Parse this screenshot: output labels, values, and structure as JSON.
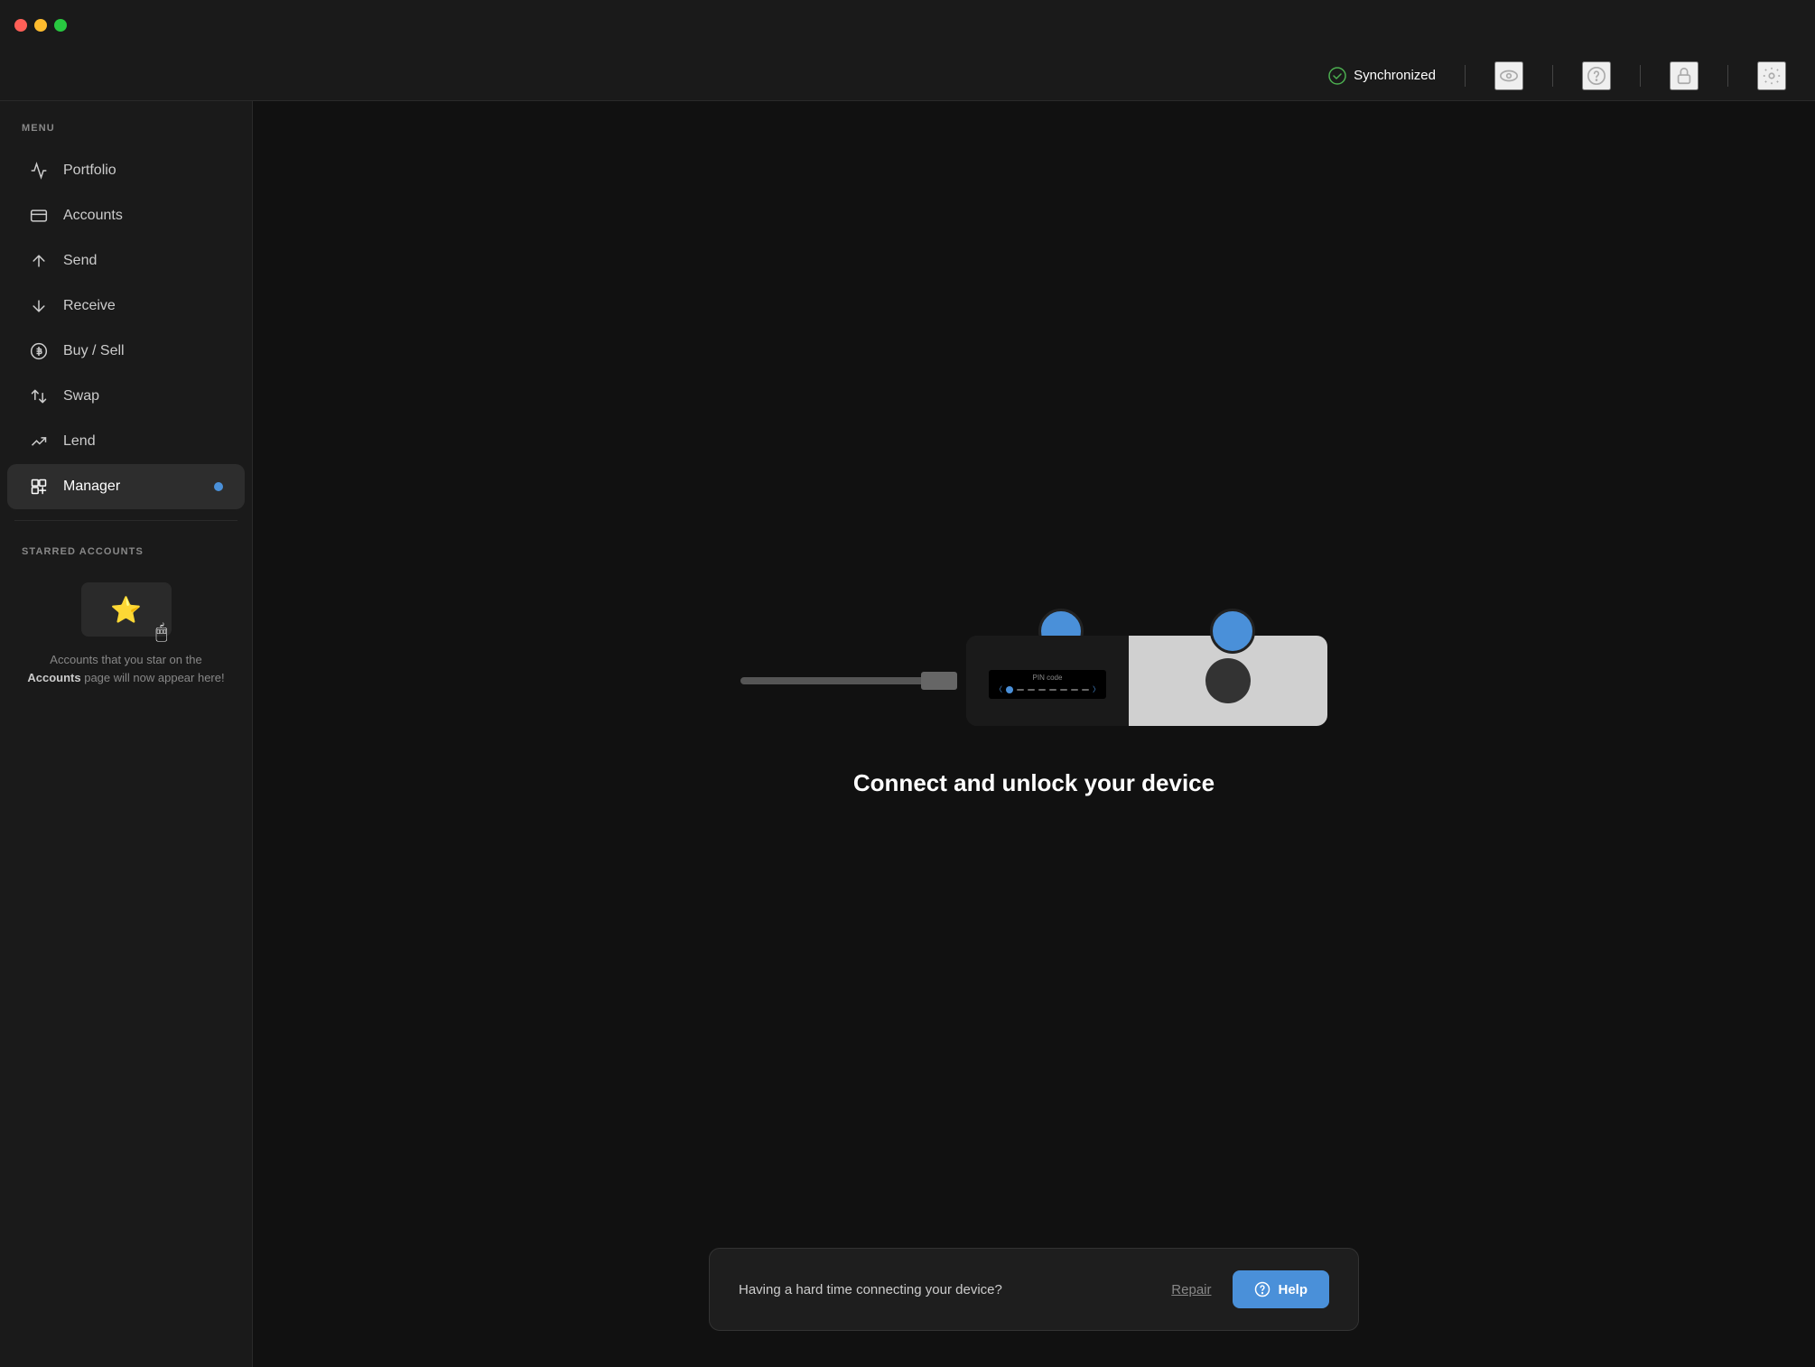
{
  "titlebar": {
    "traffic_lights": [
      "close",
      "minimize",
      "maximize"
    ]
  },
  "header": {
    "status_label": "Synchronized",
    "status_color": "#4caf50",
    "icons": [
      "eye-icon",
      "help-circle-icon",
      "lock-icon",
      "settings-icon"
    ]
  },
  "sidebar": {
    "menu_label": "MENU",
    "items": [
      {
        "id": "portfolio",
        "label": "Portfolio",
        "active": false
      },
      {
        "id": "accounts",
        "label": "Accounts",
        "active": false
      },
      {
        "id": "send",
        "label": "Send",
        "active": false
      },
      {
        "id": "receive",
        "label": "Receive",
        "active": false
      },
      {
        "id": "buy-sell",
        "label": "Buy / Sell",
        "active": false
      },
      {
        "id": "swap",
        "label": "Swap",
        "active": false
      },
      {
        "id": "lend",
        "label": "Lend",
        "active": false
      },
      {
        "id": "manager",
        "label": "Manager",
        "active": true,
        "badge": true
      }
    ],
    "starred_label": "STARRED ACCOUNTS",
    "starred_desc_part1": "Accounts that you star on the ",
    "starred_desc_link": "Accounts",
    "starred_desc_part2": " page will now appear here!"
  },
  "main": {
    "device_screen": {
      "pin_code_label": "PIN code",
      "chevron_left": "〈",
      "chevron_right": "〉"
    },
    "connect_title": "Connect and unlock your device"
  },
  "bottom_bar": {
    "text": "Having a hard time connecting your device?",
    "repair_label": "Repair",
    "help_label": "Help"
  }
}
